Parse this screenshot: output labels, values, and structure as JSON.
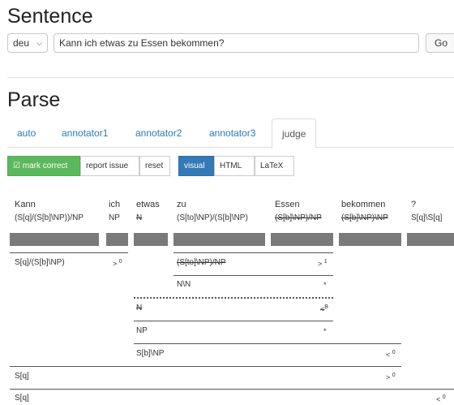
{
  "sentence": {
    "heading": "Sentence",
    "lang": "deu",
    "input_value": "Kann ich etwas zu Essen bekommen?",
    "go_label": "Go"
  },
  "parse": {
    "heading": "Parse",
    "tabs": [
      {
        "label": "auto"
      },
      {
        "label": "annotator1"
      },
      {
        "label": "annotator2"
      },
      {
        "label": "annotator3"
      },
      {
        "label": "judge"
      }
    ],
    "active_tab": "judge",
    "buttons": {
      "mark_correct": "☑ mark correct",
      "report_issue": "report issue",
      "reset": "reset",
      "visual": "visual",
      "html": "HTML",
      "latex": "LaTeX"
    },
    "tokens": [
      {
        "word": "Kann",
        "cat": "(S[q]/(S[b]\\NP))/NP"
      },
      {
        "word": "ich",
        "cat": "NP"
      },
      {
        "word": "etwas",
        "cat": "N"
      },
      {
        "word": "zu",
        "cat": "(S[to]\\NP)/(S[b]\\NP)"
      },
      {
        "word": "Essen",
        "cat": "(S[b]\\NP)/NP"
      },
      {
        "word": "bekommen",
        "cat": "(S[b]\\NP)\\NP"
      },
      {
        "word": "?",
        "cat": "S[q]\\S[q]"
      }
    ],
    "derivation": {
      "row1_left": "S[q]/(S[b]\\NP)",
      "row1_left_rule": ">",
      "row1_left_sup": "0",
      "row1_right": "(S[to]\\NP)/NP",
      "row1_right_rule": ">",
      "row1_right_sup": "1",
      "row2": "N\\N",
      "row2_rule": "*",
      "row3": "N",
      "row3_rule": "<",
      "row3_sup": "B",
      "row4": "NP",
      "row4_rule": "*",
      "row5": "S[b]\\NP",
      "row5_rule": "<",
      "row5_sup": "0",
      "row6": "S[q]",
      "row6_rule": ">",
      "row6_sup": "0",
      "row7": "S[q]",
      "row7_rule": "<",
      "row7_sup": "0"
    }
  },
  "colors": {
    "green": "#5cb85c",
    "blue": "#337ab7",
    "link": "#2a7ab8",
    "bar": "#7a7a7a"
  }
}
